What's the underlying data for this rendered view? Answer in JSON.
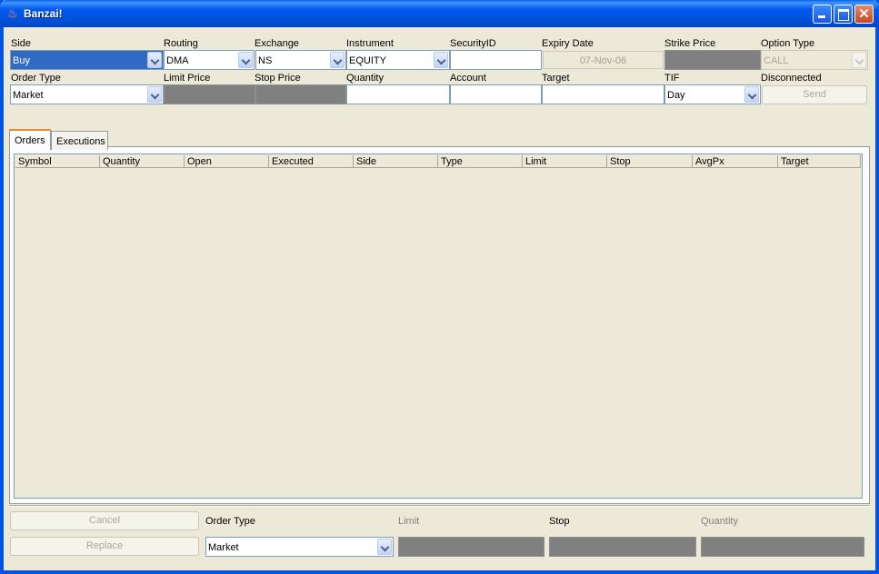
{
  "window": {
    "title": "Banzai!"
  },
  "order_entry": {
    "labels": {
      "side": "Side",
      "routing": "Routing",
      "exchange": "Exchange",
      "instrument": "Instrument",
      "security_id": "SecurityID",
      "expiry_date": "Expiry Date",
      "strike_price": "Strike Price",
      "option_type": "Option Type",
      "order_type": "Order Type",
      "limit_price": "Limit Price",
      "stop_price": "Stop Price",
      "quantity": "Quantity",
      "account": "Account",
      "target": "Target",
      "tif": "TIF",
      "status": "Disconnected"
    },
    "values": {
      "side": "Buy",
      "routing": "DMA",
      "exchange": "NS",
      "instrument": "EQUITY",
      "security_id": "",
      "expiry_date": "07-Nov-06",
      "strike_price": "",
      "option_type": "CALL",
      "order_type": "Market",
      "limit_price": "",
      "stop_price": "",
      "quantity": "",
      "account": "",
      "target": "",
      "tif": "Day"
    },
    "send_label": "Send"
  },
  "tabs": [
    {
      "label": "Orders",
      "active": true
    },
    {
      "label": "Executions",
      "active": false
    }
  ],
  "orders_table": {
    "columns": [
      "Symbol",
      "Quantity",
      "Open",
      "Executed",
      "Side",
      "Type",
      "Limit",
      "Stop",
      "AvgPx",
      "Target"
    ],
    "rows": []
  },
  "modify": {
    "cancel_label": "Cancel",
    "replace_label": "Replace",
    "labels": {
      "order_type": "Order Type",
      "limit": "Limit",
      "stop": "Stop",
      "quantity": "Quantity"
    },
    "values": {
      "order_type": "Market",
      "limit": "",
      "stop": "",
      "quantity": ""
    }
  },
  "colors": {
    "titlebar": "#0054E3",
    "selection": "#316AC5",
    "disabled_field": "#808080",
    "tab_accent": "#E68B2C"
  }
}
